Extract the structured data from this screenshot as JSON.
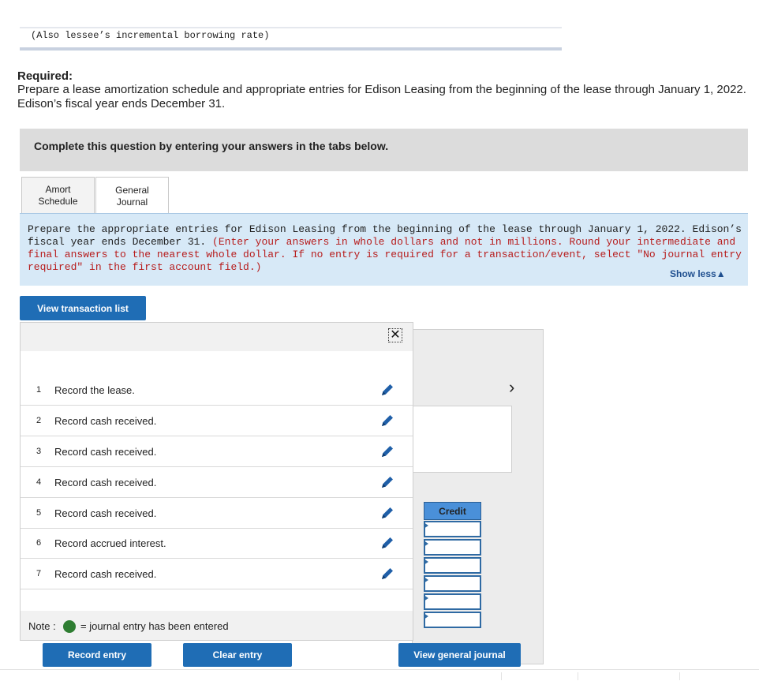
{
  "top_note": "(Also lessee’s incremental borrowing rate)",
  "required": {
    "label": "Required:",
    "text": "Prepare a lease amortization schedule and appropriate entries for Edison Leasing from the beginning of the lease through January 1, 2022. Edison’s fiscal year ends December 31."
  },
  "complete_prompt": "Complete this question by entering your answers in the tabs below.",
  "tabs": [
    {
      "line1": "Amort",
      "line2": "Schedule"
    },
    {
      "line1": "General",
      "line2": "Journal"
    }
  ],
  "instructions": {
    "main": "Prepare the appropriate entries for Edison Leasing from the beginning of the lease through January 1, 2022. Edison’s fiscal year ends December 31. ",
    "red": "(Enter your answers in whole dollars and not in millions. Round your intermediate and final answers to the nearest whole dollar. If no entry is required for a transaction/event, select \"No journal entry required\" in the first account field.)",
    "show_less": "Show less▲"
  },
  "view_transaction_list": "View transaction list",
  "close_symbol": "✕",
  "transactions": [
    {
      "num": "1",
      "desc": "Record the lease."
    },
    {
      "num": "2",
      "desc": "Record cash received."
    },
    {
      "num": "3",
      "desc": "Record cash received."
    },
    {
      "num": "4",
      "desc": "Record cash received."
    },
    {
      "num": "5",
      "desc": "Record cash received."
    },
    {
      "num": "6",
      "desc": "Record accrued interest."
    },
    {
      "num": "7",
      "desc": "Record cash received."
    }
  ],
  "note": {
    "label": "Note :",
    "text": "= journal entry has been entered",
    "dot_color": "#2e7d32"
  },
  "buttons": {
    "record": "Record entry",
    "clear": "Clear entry",
    "view_gj": "View general journal"
  },
  "right_panel": {
    "chevron": "›",
    "credit_header": "Credit"
  },
  "colors": {
    "accent": "#1f6db5",
    "instructions_bg": "#d7e9f7",
    "red_text": "#b71c1c"
  }
}
